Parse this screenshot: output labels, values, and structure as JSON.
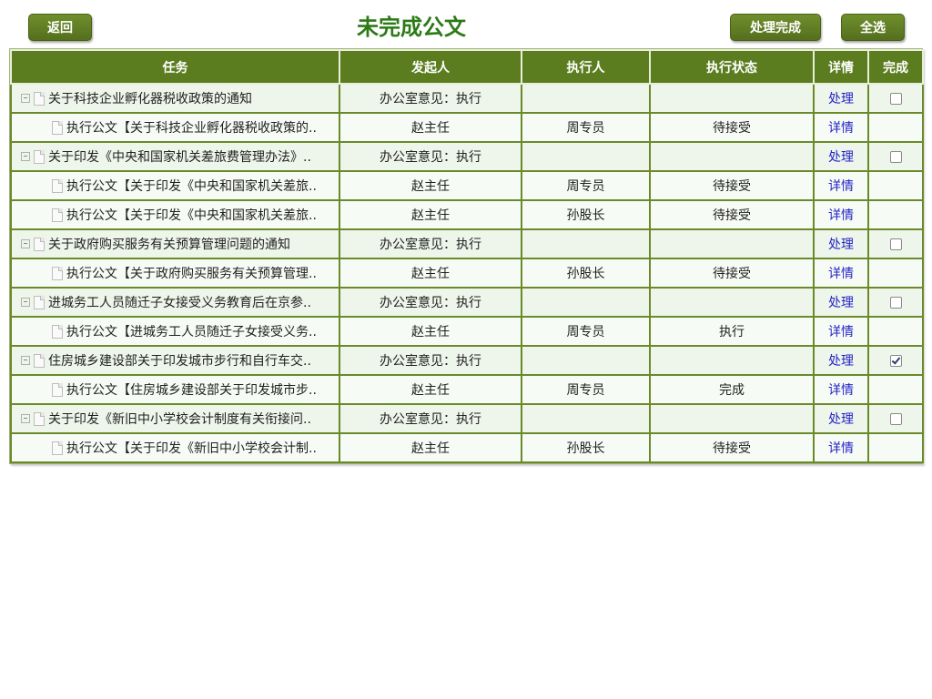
{
  "header": {
    "title": "未完成公文",
    "back_label": "返回",
    "process_label": "处理完成",
    "select_all_label": "全选"
  },
  "table": {
    "columns": [
      "任务",
      "发起人",
      "执行人",
      "执行状态",
      "详情",
      "完成"
    ],
    "rows": [
      {
        "type": "parent",
        "task": "关于科技企业孵化器税收政策的通知",
        "initiator": "办公室意见：执行",
        "executor": "",
        "status": "",
        "link": "处理",
        "checked": false
      },
      {
        "type": "child",
        "task": "执行公文【关于科技企业孵化器税收政策的..",
        "initiator": "赵主任",
        "executor": "周专员",
        "status": "待接受",
        "link": "详情"
      },
      {
        "type": "parent",
        "task": "关于印发《中央和国家机关差旅费管理办法》..",
        "initiator": "办公室意见：执行",
        "executor": "",
        "status": "",
        "link": "处理",
        "checked": false
      },
      {
        "type": "child",
        "task": "执行公文【关于印发《中央和国家机关差旅..",
        "initiator": "赵主任",
        "executor": "周专员",
        "status": "待接受",
        "link": "详情"
      },
      {
        "type": "child",
        "task": "执行公文【关于印发《中央和国家机关差旅..",
        "initiator": "赵主任",
        "executor": "孙股长",
        "status": "待接受",
        "link": "详情"
      },
      {
        "type": "parent",
        "task": "关于政府购买服务有关预算管理问题的通知",
        "initiator": "办公室意见：执行",
        "executor": "",
        "status": "",
        "link": "处理",
        "checked": false
      },
      {
        "type": "child",
        "task": "执行公文【关于政府购买服务有关预算管理..",
        "initiator": "赵主任",
        "executor": "孙股长",
        "status": "待接受",
        "link": "详情"
      },
      {
        "type": "parent",
        "task": "进城务工人员随迁子女接受义务教育后在京参..",
        "initiator": "办公室意见：执行",
        "executor": "",
        "status": "",
        "link": "处理",
        "checked": false
      },
      {
        "type": "child",
        "task": "执行公文【进城务工人员随迁子女接受义务..",
        "initiator": "赵主任",
        "executor": "周专员",
        "status": "执行",
        "link": "详情"
      },
      {
        "type": "parent",
        "task": "住房城乡建设部关于印发城市步行和自行车交..",
        "initiator": "办公室意见：执行",
        "executor": "",
        "status": "",
        "link": "处理",
        "checked": true
      },
      {
        "type": "child",
        "task": "执行公文【住房城乡建设部关于印发城市步..",
        "initiator": "赵主任",
        "executor": "周专员",
        "status": "完成",
        "link": "详情"
      },
      {
        "type": "parent",
        "task": "关于印发《新旧中小学校会计制度有关衔接问..",
        "initiator": "办公室意见：执行",
        "executor": "",
        "status": "",
        "link": "处理",
        "checked": false
      },
      {
        "type": "child",
        "task": "执行公文【关于印发《新旧中小学校会计制..",
        "initiator": "赵主任",
        "executor": "孙股长",
        "status": "待接受",
        "link": "详情"
      }
    ]
  }
}
